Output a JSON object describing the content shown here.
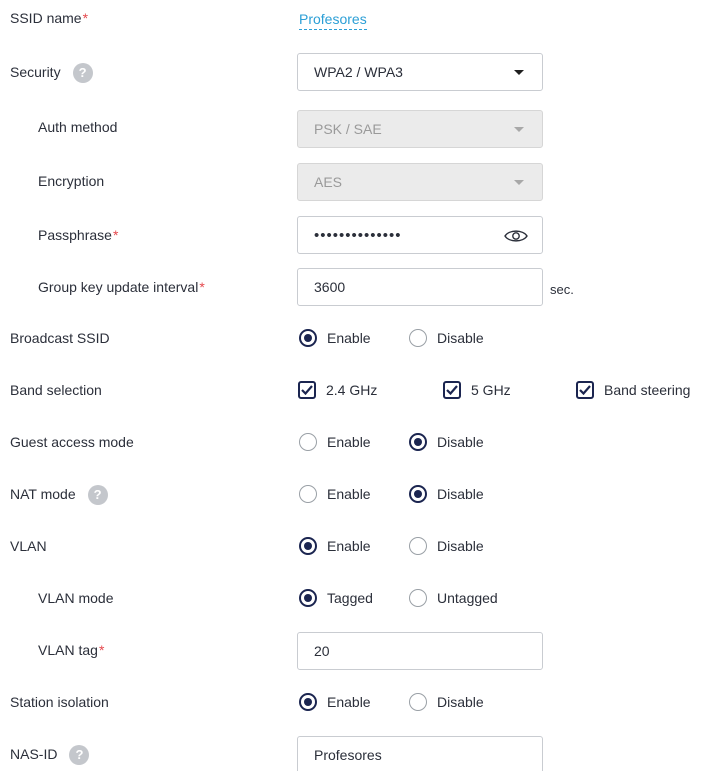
{
  "ssid": {
    "label": "SSID name",
    "value": "Profesores"
  },
  "security": {
    "label": "Security",
    "help": "?",
    "value": "WPA2 / WPA3"
  },
  "auth_method": {
    "label": "Auth method",
    "value": "PSK / SAE"
  },
  "encryption": {
    "label": "Encryption",
    "value": "AES"
  },
  "passphrase": {
    "label": "Passphrase",
    "masked": "••••••••••••••"
  },
  "group_key": {
    "label": "Group key update interval",
    "value": "3600",
    "unit": "sec."
  },
  "broadcast_ssid": {
    "label": "Broadcast SSID",
    "options": [
      "Enable",
      "Disable"
    ],
    "selected": "Enable"
  },
  "band_selection": {
    "label": "Band selection",
    "options": [
      "2.4 GHz",
      "5 GHz",
      "Band steering"
    ],
    "checked": [
      true,
      true,
      true
    ]
  },
  "guest_access": {
    "label": "Guest access mode",
    "options": [
      "Enable",
      "Disable"
    ],
    "selected": "Disable"
  },
  "nat_mode": {
    "label": "NAT mode",
    "help": "?",
    "options": [
      "Enable",
      "Disable"
    ],
    "selected": "Disable"
  },
  "vlan": {
    "label": "VLAN",
    "options": [
      "Enable",
      "Disable"
    ],
    "selected": "Enable"
  },
  "vlan_mode": {
    "label": "VLAN mode",
    "options": [
      "Tagged",
      "Untagged"
    ],
    "selected": "Tagged"
  },
  "vlan_tag": {
    "label": "VLAN tag",
    "value": "20"
  },
  "station_isolation": {
    "label": "Station isolation",
    "options": [
      "Enable",
      "Disable"
    ],
    "selected": "Enable"
  },
  "nas_id": {
    "label": "NAS-ID",
    "help": "?",
    "value": "Profesores"
  },
  "required_mark": "*",
  "colors": {
    "accent": "#1b2550",
    "link": "#2c9fd6",
    "required": "#e5484d"
  },
  "icons": {
    "help": "question-circle-icon",
    "eye": "eye-icon",
    "caret": "caret-down-icon"
  }
}
